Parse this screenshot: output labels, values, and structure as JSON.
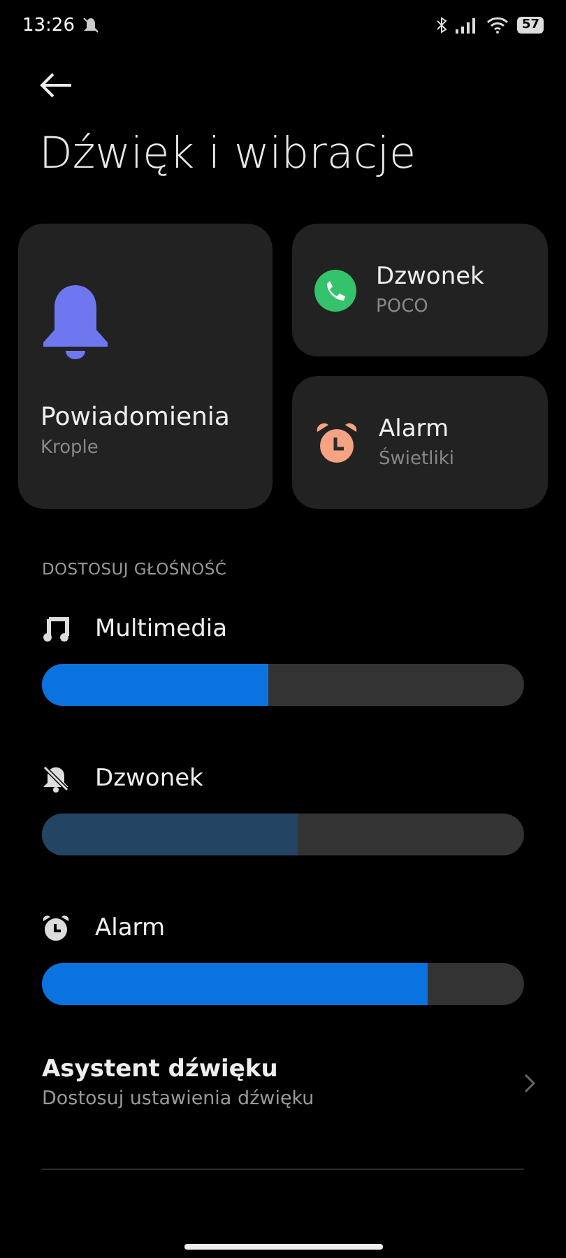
{
  "status_bar": {
    "time": "13:26",
    "battery": "57"
  },
  "title": "Dźwięk i wibracje",
  "cards": [
    {
      "kind": "bell",
      "title": "Powiadomienia",
      "subtitle": "Krople"
    },
    {
      "kind": "phone",
      "title": "Dzwonek",
      "subtitle": "POCO"
    },
    {
      "kind": "alarm",
      "title": "Alarm",
      "subtitle": "Świetliki"
    }
  ],
  "section_label": "DOSTOSUJ GŁOŚNOŚĆ",
  "volumes": [
    {
      "kind": "music",
      "label": "Multimedia",
      "muted": false,
      "level": 0.47
    },
    {
      "kind": "ringer",
      "label": "Dzwonek",
      "muted": true,
      "level": 0.53
    },
    {
      "kind": "alarm",
      "label": "Alarm",
      "muted": false,
      "level": 0.8
    }
  ],
  "assistant": {
    "title": "Asystent dźwięku",
    "subtitle": "Dostosuj ustawienia dźwięku"
  }
}
